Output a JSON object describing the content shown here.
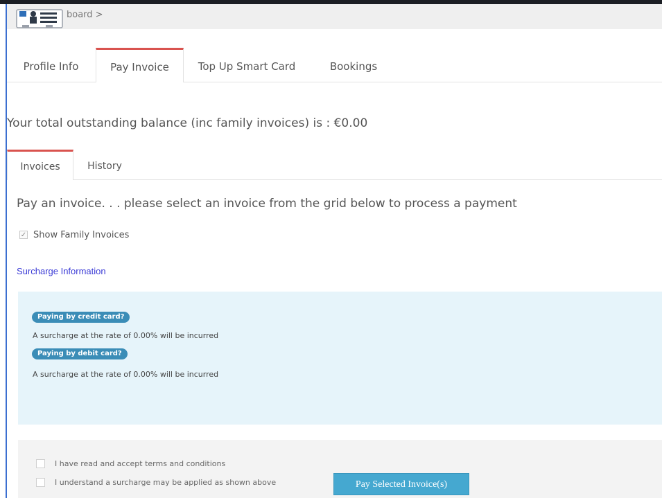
{
  "breadcrumb": {
    "text": "board >"
  },
  "main_tabs": [
    {
      "label": "Profile Info"
    },
    {
      "label": "Pay Invoice"
    },
    {
      "label": "Top Up Smart Card"
    },
    {
      "label": "Bookings"
    }
  ],
  "active_main_tab": "Pay Invoice",
  "balance_text": "Your total outstanding balance (inc family invoices) is : €0.00",
  "sub_tabs": [
    {
      "label": "Invoices"
    },
    {
      "label": "History"
    }
  ],
  "active_sub_tab": "Invoices",
  "pay_heading": "Pay an invoice. . . please select an invoice from the grid below to process a payment",
  "family_checkbox": {
    "label": "Show Family Invoices",
    "checked": true
  },
  "surcharge_link": "Surcharge Information",
  "surcharges": [
    {
      "badge": "Paying by credit card?",
      "text": "A surcharge at the rate of 0.00% will be incurred"
    },
    {
      "badge": "Paying by debit card?",
      "text": "A surcharge at the rate of 0.00% will be incurred"
    }
  ],
  "terms": [
    {
      "label": "I have read and accept terms and conditions",
      "checked": false
    },
    {
      "label": "I understand a surcharge may be applied as shown above",
      "checked": false
    }
  ],
  "pay_button_label": "Pay Selected Invoice(s)",
  "colors": {
    "accent_tab": "#d9534f",
    "badge": "#3b8db7",
    "info_bg": "#e6f4fa",
    "button": "#45a8d0",
    "link": "#3b3bd6"
  }
}
